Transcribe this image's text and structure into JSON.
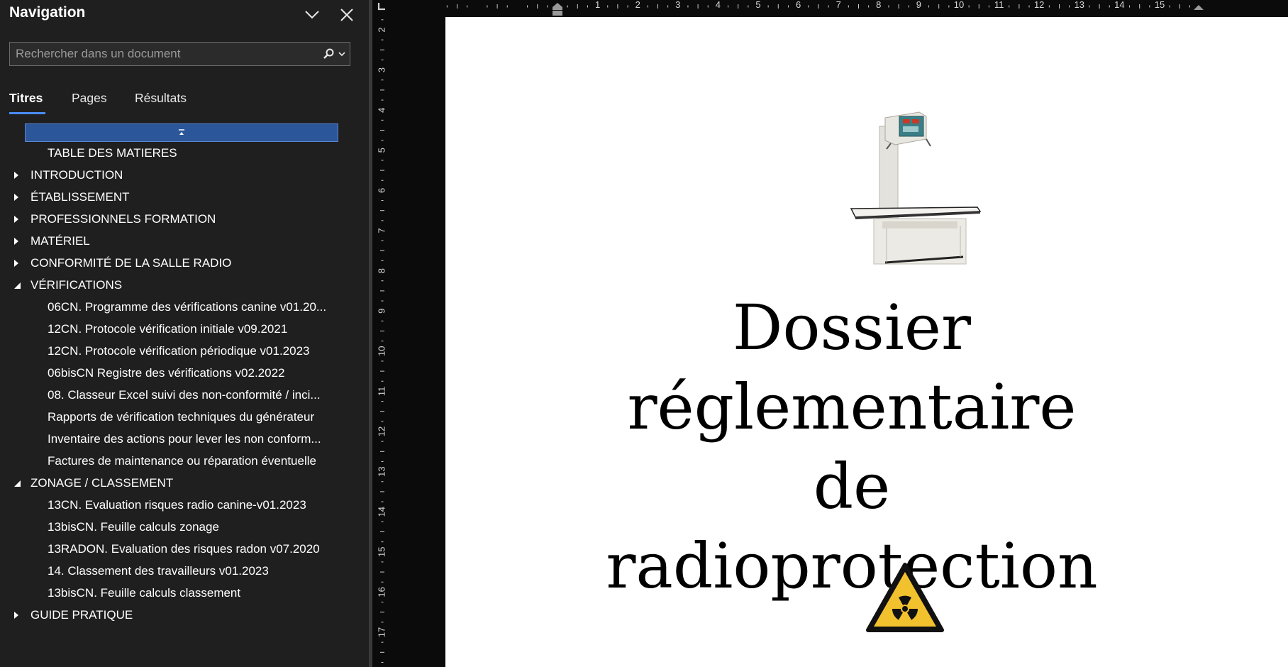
{
  "nav": {
    "title": "Navigation",
    "search_placeholder": "Rechercher dans un document",
    "tabs": [
      {
        "label": "Titres",
        "active": true
      },
      {
        "label": "Pages",
        "active": false
      },
      {
        "label": "Résultats",
        "active": false
      }
    ],
    "items": [
      {
        "label": "TABLE DES MATIERES",
        "level": 2,
        "expander": "none"
      },
      {
        "label": "INTRODUCTION",
        "level": 1,
        "expander": "collapsed"
      },
      {
        "label": "ÉTABLISSEMENT",
        "level": 1,
        "expander": "collapsed"
      },
      {
        "label": "PROFESSIONNELS FORMATION",
        "level": 1,
        "expander": "collapsed"
      },
      {
        "label": "MATÉRIEL",
        "level": 1,
        "expander": "collapsed"
      },
      {
        "label": "CONFORMITÉ DE LA SALLE RADIO",
        "level": 1,
        "expander": "collapsed"
      },
      {
        "label": "VÉRIFICATIONS",
        "level": 1,
        "expander": "expanded"
      },
      {
        "label": "06CN. Programme des vérifications canine v01.20...",
        "level": 2,
        "expander": "none"
      },
      {
        "label": "12CN. Protocole vérification initiale v09.2021",
        "level": 2,
        "expander": "none"
      },
      {
        "label": "12CN. Protocole vérification périodique v01.2023",
        "level": 2,
        "expander": "none"
      },
      {
        "label": "06bisCN Registre des vérifications v02.2022",
        "level": 2,
        "expander": "none"
      },
      {
        "label": "08. Classeur Excel suivi des non-conformité / inci...",
        "level": 2,
        "expander": "none"
      },
      {
        "label": "Rapports de vérification techniques du générateur",
        "level": 2,
        "expander": "none"
      },
      {
        "label": "Inventaire des actions pour lever les non conform...",
        "level": 2,
        "expander": "none"
      },
      {
        "label": "Factures de maintenance ou réparation éventuelle",
        "level": 2,
        "expander": "none"
      },
      {
        "label": "ZONAGE / CLASSEMENT",
        "level": 1,
        "expander": "expanded"
      },
      {
        "label": "13CN. Evaluation risques radio canine-v01.2023",
        "level": 2,
        "expander": "none"
      },
      {
        "label": "13bisCN. Feuille calculs zonage",
        "level": 2,
        "expander": "none"
      },
      {
        "label": "13RADON. Evaluation des risques radon v07.2020",
        "level": 2,
        "expander": "none"
      },
      {
        "label": "14. Classement des travailleurs v01.2023",
        "level": 2,
        "expander": "none"
      },
      {
        "label": "13bisCN. Feuille calculs classement",
        "level": 2,
        "expander": "none"
      },
      {
        "label": "GUIDE PRATIQUE",
        "level": 1,
        "expander": "collapsed"
      }
    ]
  },
  "rulers": {
    "horizontal_ticks": [
      "1",
      "2",
      "3",
      "4",
      "5",
      "6",
      "7",
      "8",
      "9",
      "10",
      "11",
      "12",
      "13",
      "14",
      "15"
    ],
    "vertical_ticks": [
      "2",
      "3",
      "4",
      "5",
      "6",
      "7",
      "8",
      "9",
      "10",
      "11",
      "12",
      "13",
      "14",
      "15",
      "16",
      "17"
    ]
  },
  "document": {
    "title_lines": [
      "Dossier",
      "réglementaire de",
      "radioprotection"
    ]
  },
  "colors": {
    "nav_background": "#1f1f1f",
    "selection": "#2b579a",
    "tab_underline": "#4a8cf7",
    "hazard_yellow": "#f2c12e"
  }
}
